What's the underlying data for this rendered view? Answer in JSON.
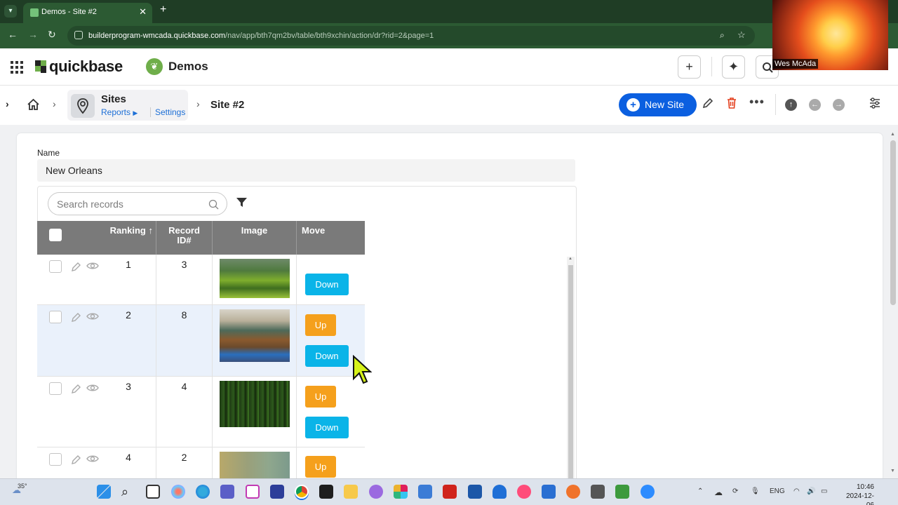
{
  "browser": {
    "tab_title": "Demos - Site #2",
    "url_domain": "builderprogram-wmcada.quickbase.com",
    "url_path": "/nav/app/bth7qm2bv/table/bth9xchin/action/dr?rid=2&page=1"
  },
  "header": {
    "brand": "quickbase",
    "app_name": "Demos"
  },
  "breadcrumb": {
    "table_name": "Sites",
    "reports_label": "Reports",
    "settings_label": "Settings",
    "record_title": "Site #2"
  },
  "toolbar": {
    "new_button_label": "New Site"
  },
  "form": {
    "name_label": "Name",
    "name_value": "New Orleans"
  },
  "report": {
    "search_placeholder": "Search records",
    "columns": {
      "ranking": "Ranking ↑",
      "record_id_line1": "Record",
      "record_id_line2": "ID#",
      "image": "Image",
      "move": "Move"
    },
    "rows": [
      {
        "ranking": "1",
        "record_id": "3",
        "up": "",
        "down": "Down",
        "image": "green-hills"
      },
      {
        "ranking": "2",
        "record_id": "8",
        "up": "Up",
        "down": "Down",
        "image": "jars-on-tray"
      },
      {
        "ranking": "3",
        "record_id": "4",
        "up": "Up",
        "down": "Down",
        "image": "forest"
      },
      {
        "ranking": "4",
        "record_id": "2",
        "up": "Up",
        "down": "",
        "image": "foggy-landscape"
      }
    ]
  },
  "webcam": {
    "participant_name": "Wes McAda"
  },
  "taskbar": {
    "weather": "35°",
    "language": "ENG",
    "time": "10:46",
    "date": "2024-12-06"
  },
  "colors": {
    "browser_frame": "#2c5a33",
    "primary_blue": "#0b5fe0",
    "up_orange": "#f5a01c",
    "down_cyan": "#0ab4e8",
    "table_header_gray": "#7a7a7a"
  }
}
